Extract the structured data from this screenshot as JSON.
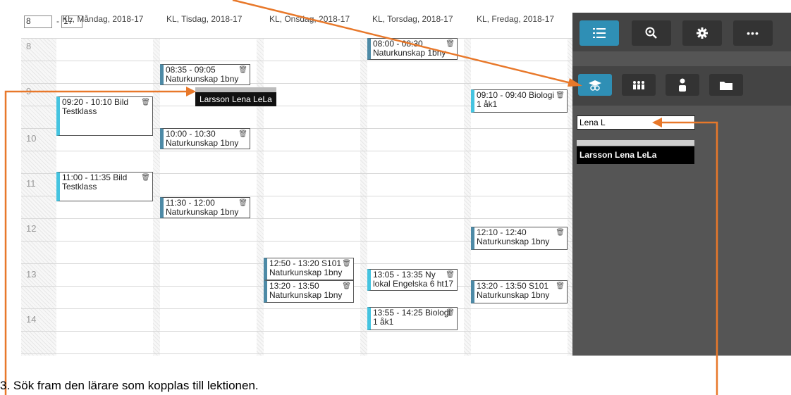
{
  "calendar": {
    "week_from": "8",
    "week_to": "17",
    "days": [
      "KL, Måndag, 2018-17",
      "KL, Tisdag, 2018-17",
      "KL, Onsdag, 2018-17",
      "KL, Torsdag, 2018-17",
      "KL, Fredag, 2018-17"
    ],
    "hours": [
      "8",
      "9",
      "10",
      "11",
      "12",
      "13",
      "14"
    ],
    "events": {
      "mon1": {
        "time": "09:20 - 10:10 Bild",
        "title": "Testklass"
      },
      "mon2": {
        "time": "11:00 - 11:35 Bild",
        "title": "Testklass"
      },
      "tue1": {
        "time": "08:35 - 09:05",
        "title": "Naturkunskap 1bny"
      },
      "tue2": {
        "time": "10:00 - 10:30",
        "title": "Naturkunskap 1bny"
      },
      "tue3": {
        "time": "11:30 - 12:00",
        "title": "Naturkunskap 1bny"
      },
      "wed1": {
        "time": "12:50 - 13:20 S101",
        "title": "Naturkunskap 1bny"
      },
      "wed2": {
        "time": "13:20 - 13:50",
        "title": "Naturkunskap 1bny"
      },
      "thu1": {
        "time": "08:00 - 08:30",
        "title": "Naturkunskap 1bny"
      },
      "thu2": {
        "time": "13:05 - 13:35 Ny",
        "title": "lokal Engelska 6 ht17"
      },
      "thu3": {
        "time": "13:55 - 14:25 Biologi",
        "title": "1 åk1"
      },
      "fri1": {
        "time": "09:10 - 09:40 Biologi",
        "title": "1 åk1"
      },
      "fri2": {
        "time": "12:10 - 12:40",
        "title": "Naturkunskap 1bny"
      },
      "fri3": {
        "time": "13:20 - 13:50 S101",
        "title": "Naturkunskap 1bny"
      }
    },
    "trash_glyph": "🗑"
  },
  "tooltip": {
    "text": "Larsson   Lena   LeLa"
  },
  "panel": {
    "top_buttons": [
      "list-icon",
      "zoom-icon",
      "gear-icon",
      "more-icon"
    ],
    "more_label": "•••",
    "filter_buttons": [
      "student-hat-icon",
      "group-icon",
      "person-icon",
      "folder-icon"
    ],
    "search_value": "Lena L",
    "result": "Larsson Lena LeLa"
  },
  "instruction": "3.   Sök fram den lärare som kopplas till lektionen.",
  "colors": {
    "accent": "#2f8fb5",
    "arrow": "#e8782a",
    "panel": "#555555"
  }
}
